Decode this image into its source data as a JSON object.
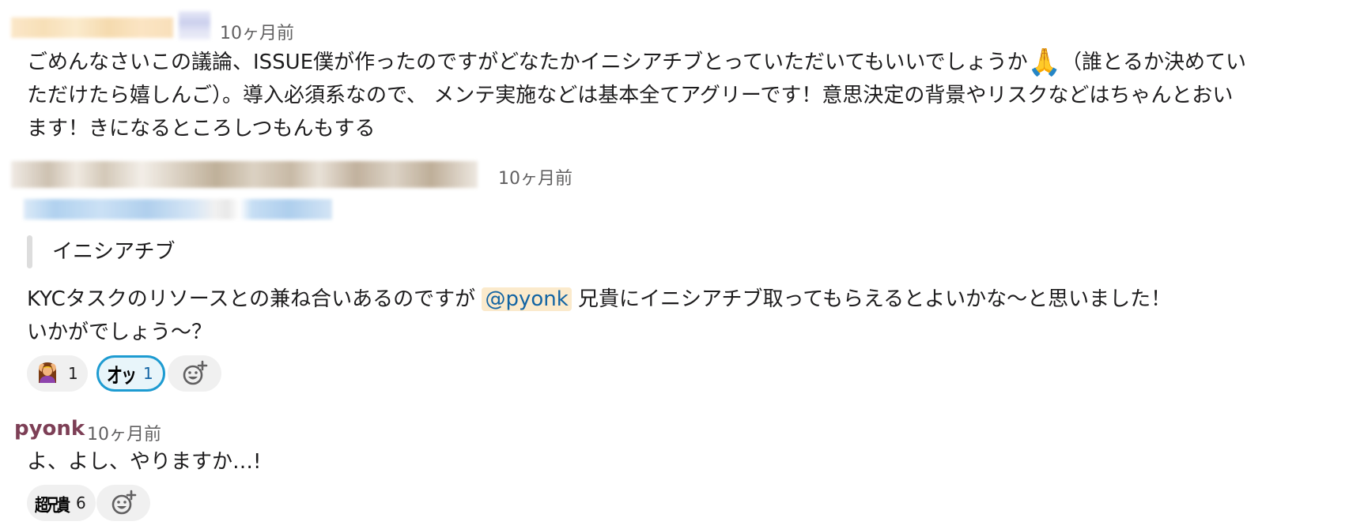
{
  "messages": [
    {
      "timestamp": "10ヶ月前",
      "lines": [
        "ごめんなさいこの議論、ISSUE僕が作ったのですがどなたかイニシアチブとっていただいてもいいでしょうか",
        "（誰とるか決めてい",
        "ただけたら嬉しんご）。導入必須系なので、 メンテ実施などは基本全てアグリーです！意思決定の背景やリスクなどはちゃんとおい",
        "ます！きになるところしつもんもする"
      ],
      "inline_emoji": "🙏"
    },
    {
      "timestamp": "10ヶ月前",
      "quote": "イニシアチブ",
      "line1_before": "KYCタスクのリソースとの兼ね合いあるのですが ",
      "mention": "@pyonk",
      "line1_after": " 兄貴にイニシアチブ取ってもらえるとよいかな〜と思いました！",
      "line2": "いかがでしょう〜？",
      "reactions": [
        {
          "emoji": "person-gesturing-ok",
          "count": "1",
          "active": false
        },
        {
          "emoji": "オッ",
          "count": "1",
          "active": true
        }
      ]
    },
    {
      "username": "pyonk",
      "timestamp": "10ヶ月前",
      "text": "よ、よし、やりますか…!",
      "reactions": [
        {
          "emoji": "超兄貴",
          "count": "6",
          "active": false
        }
      ]
    }
  ],
  "colors": {
    "username": "#7d3f56",
    "mention_bg": "#fbeacc",
    "mention_fg": "#1264a3",
    "reaction_active_border": "#1d9bd1"
  }
}
